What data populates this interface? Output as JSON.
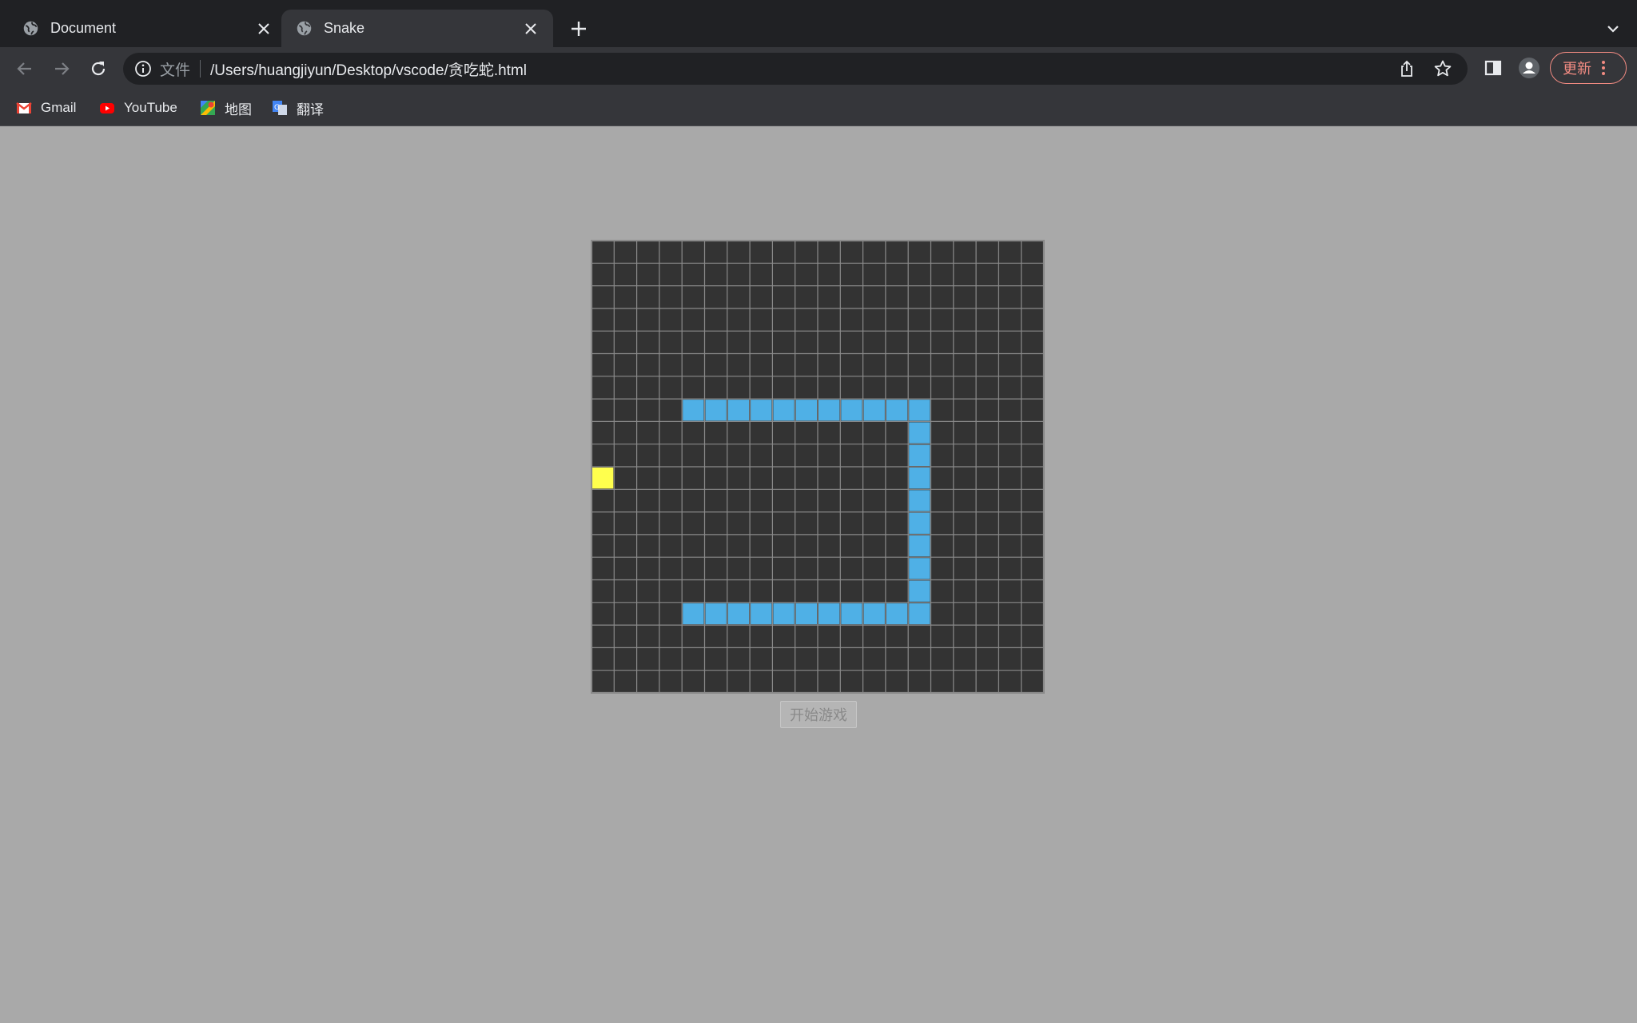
{
  "tabs": [
    {
      "title": "Document",
      "active": false,
      "icon": "globe-icon"
    },
    {
      "title": "Snake",
      "active": true,
      "icon": "globe-icon"
    }
  ],
  "toolbar": {
    "scheme_label": "文件",
    "url": "/Users/huangjiyun/Desktop/vscode/贪吃蛇.html",
    "update_label": "更新"
  },
  "bookmarks": [
    {
      "label": "Gmail",
      "icon": "gmail-icon"
    },
    {
      "label": "YouTube",
      "icon": "youtube-icon"
    },
    {
      "label": "地图",
      "icon": "maps-icon"
    },
    {
      "label": "翻译",
      "icon": "translate-icon"
    }
  ],
  "game": {
    "start_label": "开始游戏",
    "grid_cols": 20,
    "grid_rows": 20,
    "colors": {
      "background": "#333333",
      "grid_line": "#8a8a8a",
      "snake": "#4fb0e6",
      "food": "#ffff4d",
      "page": "#a9a9a9"
    },
    "food": {
      "col": 0,
      "row": 10
    },
    "snake": [
      [
        4,
        7
      ],
      [
        5,
        7
      ],
      [
        6,
        7
      ],
      [
        7,
        7
      ],
      [
        8,
        7
      ],
      [
        9,
        7
      ],
      [
        10,
        7
      ],
      [
        11,
        7
      ],
      [
        12,
        7
      ],
      [
        13,
        7
      ],
      [
        14,
        7
      ],
      [
        14,
        8
      ],
      [
        14,
        9
      ],
      [
        14,
        10
      ],
      [
        14,
        11
      ],
      [
        14,
        12
      ],
      [
        14,
        13
      ],
      [
        14,
        14
      ],
      [
        14,
        15
      ],
      [
        14,
        16
      ],
      [
        13,
        16
      ],
      [
        12,
        16
      ],
      [
        11,
        16
      ],
      [
        10,
        16
      ],
      [
        9,
        16
      ],
      [
        8,
        16
      ],
      [
        7,
        16
      ],
      [
        6,
        16
      ],
      [
        5,
        16
      ],
      [
        4,
        16
      ]
    ]
  }
}
